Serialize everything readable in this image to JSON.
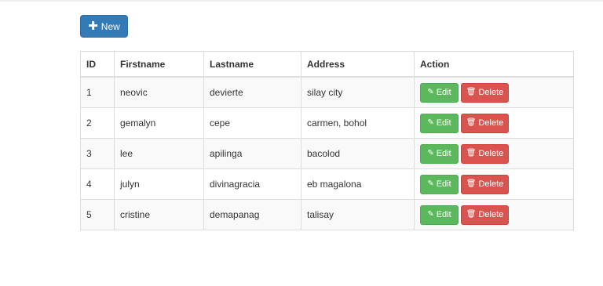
{
  "toolbar": {
    "new_label": "New",
    "new_icon": "plus-icon"
  },
  "table": {
    "headers": [
      "ID",
      "Firstname",
      "Lastname",
      "Address",
      "Action"
    ],
    "rows": [
      {
        "id": "1",
        "firstname": "neovic",
        "lastname": "devierte",
        "address": "silay city"
      },
      {
        "id": "2",
        "firstname": "gemalyn",
        "lastname": "cepe",
        "address": "carmen, bohol"
      },
      {
        "id": "3",
        "firstname": "lee",
        "lastname": "apilinga",
        "address": "bacolod"
      },
      {
        "id": "4",
        "firstname": "julyn",
        "lastname": "divinagracia",
        "address": "eb magalona"
      },
      {
        "id": "5",
        "firstname": "cristine",
        "lastname": "demapanag",
        "address": "talisay"
      }
    ],
    "edit_label": "Edit",
    "delete_label": "Delete"
  },
  "colors": {
    "primary": "#337ab7",
    "success": "#5cb85c",
    "danger": "#d9534f"
  }
}
